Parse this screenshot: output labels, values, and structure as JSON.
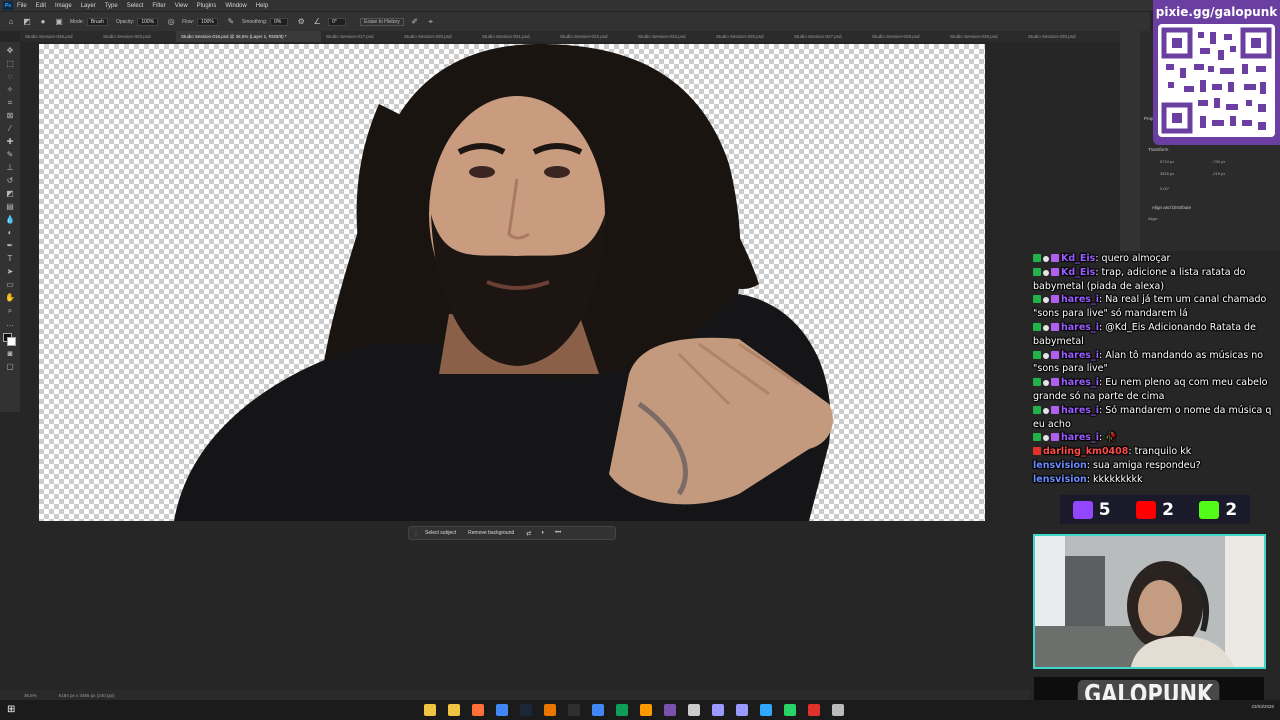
{
  "app": {
    "logo": "Ps",
    "menu": [
      "File",
      "Edit",
      "Image",
      "Layer",
      "Type",
      "Select",
      "Filter",
      "View",
      "Plugins",
      "Window",
      "Help"
    ]
  },
  "options_bar": {
    "mode_label": "Mode:",
    "mode_value": "Brush",
    "opacity_label": "Opacity:",
    "opacity_value": "100%",
    "flow_label": "Flow:",
    "flow_value": "100%",
    "smoothing_label": "Smoothing:",
    "smoothing_value": "0%",
    "angle_value": "0°",
    "erase_history_label": "Erase to History"
  },
  "doc_tabs": [
    "Studio Session-046.psd",
    "Studio Session-003.psd",
    "Studio Session-016.psd @ 36,5% (Layer 1, RGB/8) *",
    "Studio Session-017.psd",
    "Studio Session-020.psd",
    "Studio Session-021.psd",
    "Studio Session-022.psd",
    "Studio Session-023.psd",
    "Studio Session-025.psd",
    "Studio Session-027.psd",
    "Studio Session-028.psd",
    "Studio Session-029.psd",
    "Studio Session-030.psd"
  ],
  "context_bar": {
    "select_subject": "Select subject",
    "remove_background": "Remove background"
  },
  "status": {
    "zoom": "36,5%",
    "doc_size": "5184 px x 3456 px (240 ppi)"
  },
  "properties_panel": {
    "title": "Properties",
    "transform_label": "Transform",
    "w_value": "5724 px",
    "h_value": "3816 px",
    "x_value": "-730 px",
    "y_value": "-219 px",
    "angle_value": "0,00°",
    "align_label": "Align and Distribute",
    "align_sub": "Align:"
  },
  "overlay": {
    "qr_link": "pixie.gg/galopunk",
    "chat": [
      {
        "user": "Kd_Eis",
        "user_color": "purple",
        "badges": [
          "green",
          "dot",
          "sub"
        ],
        "message": ": quero almoçar"
      },
      {
        "user": "Kd_Eis",
        "user_color": "purple",
        "badges": [
          "green",
          "dot",
          "sub"
        ],
        "message": ": trap, adicione a lista ratata do babymetal (piada de alexa)"
      },
      {
        "user": "hares_i",
        "user_color": "purple",
        "badges": [
          "green",
          "dot",
          "sub"
        ],
        "message": ": Na real já tem um canal chamado \"sons para live\" só mandarem lá"
      },
      {
        "user": "hares_i",
        "user_color": "purple",
        "badges": [
          "green",
          "dot",
          "sub"
        ],
        "message": ": @Kd_Eis Adicionando Ratata de babymetal"
      },
      {
        "user": "hares_i",
        "user_color": "purple",
        "badges": [
          "green",
          "dot",
          "sub"
        ],
        "message": ": Alan tô mandando as músicas no \"sons para live\""
      },
      {
        "user": "hares_i",
        "user_color": "purple",
        "badges": [
          "green",
          "dot",
          "sub"
        ],
        "message": ": Eu nem pleno aq com meu cabelo grande só na parte de cima"
      },
      {
        "user": "hares_i",
        "user_color": "purple",
        "badges": [
          "green",
          "dot",
          "sub"
        ],
        "message": ": Só mandarem o nome da música q eu acho"
      },
      {
        "user": "hares_i",
        "user_color": "purple",
        "badges": [
          "green",
          "dot",
          "sub"
        ],
        "message": ": 🥀"
      },
      {
        "user": "darling_km0408",
        "user_color": "red",
        "badges": [
          "red"
        ],
        "message": ": tranquilo kk"
      },
      {
        "user": "lensvision",
        "user_color": "blue",
        "badges": [],
        "message": ": sua amiga respondeu?"
      },
      {
        "user": "lensvision",
        "user_color": "blue",
        "badges": [],
        "message": ": kkkkkkkkk"
      }
    ],
    "viewers": [
      {
        "platform": "twitch-icon",
        "count": "5",
        "color": "#9146ff"
      },
      {
        "platform": "youtube-icon",
        "count": "2",
        "color": "#ff0000"
      },
      {
        "platform": "kick-icon",
        "count": "2",
        "color": "#53fc18"
      }
    ],
    "brand": "GALOPUNK"
  },
  "taskbar": {
    "time": "23/03/2026",
    "apps": [
      "file-explorer-icon",
      "folder-icon",
      "firefox-icon",
      "chrome-icon",
      "steam-icon",
      "blender-icon",
      "obs-icon",
      "chrome-icon-2",
      "app-icon-1",
      "illustrator-icon",
      "app-icon-2",
      "back-icon",
      "after-effects-icon",
      "premiere-icon",
      "photoshop-icon",
      "whatsapp-icon",
      "app-icon-3",
      "settings-icon"
    ]
  }
}
